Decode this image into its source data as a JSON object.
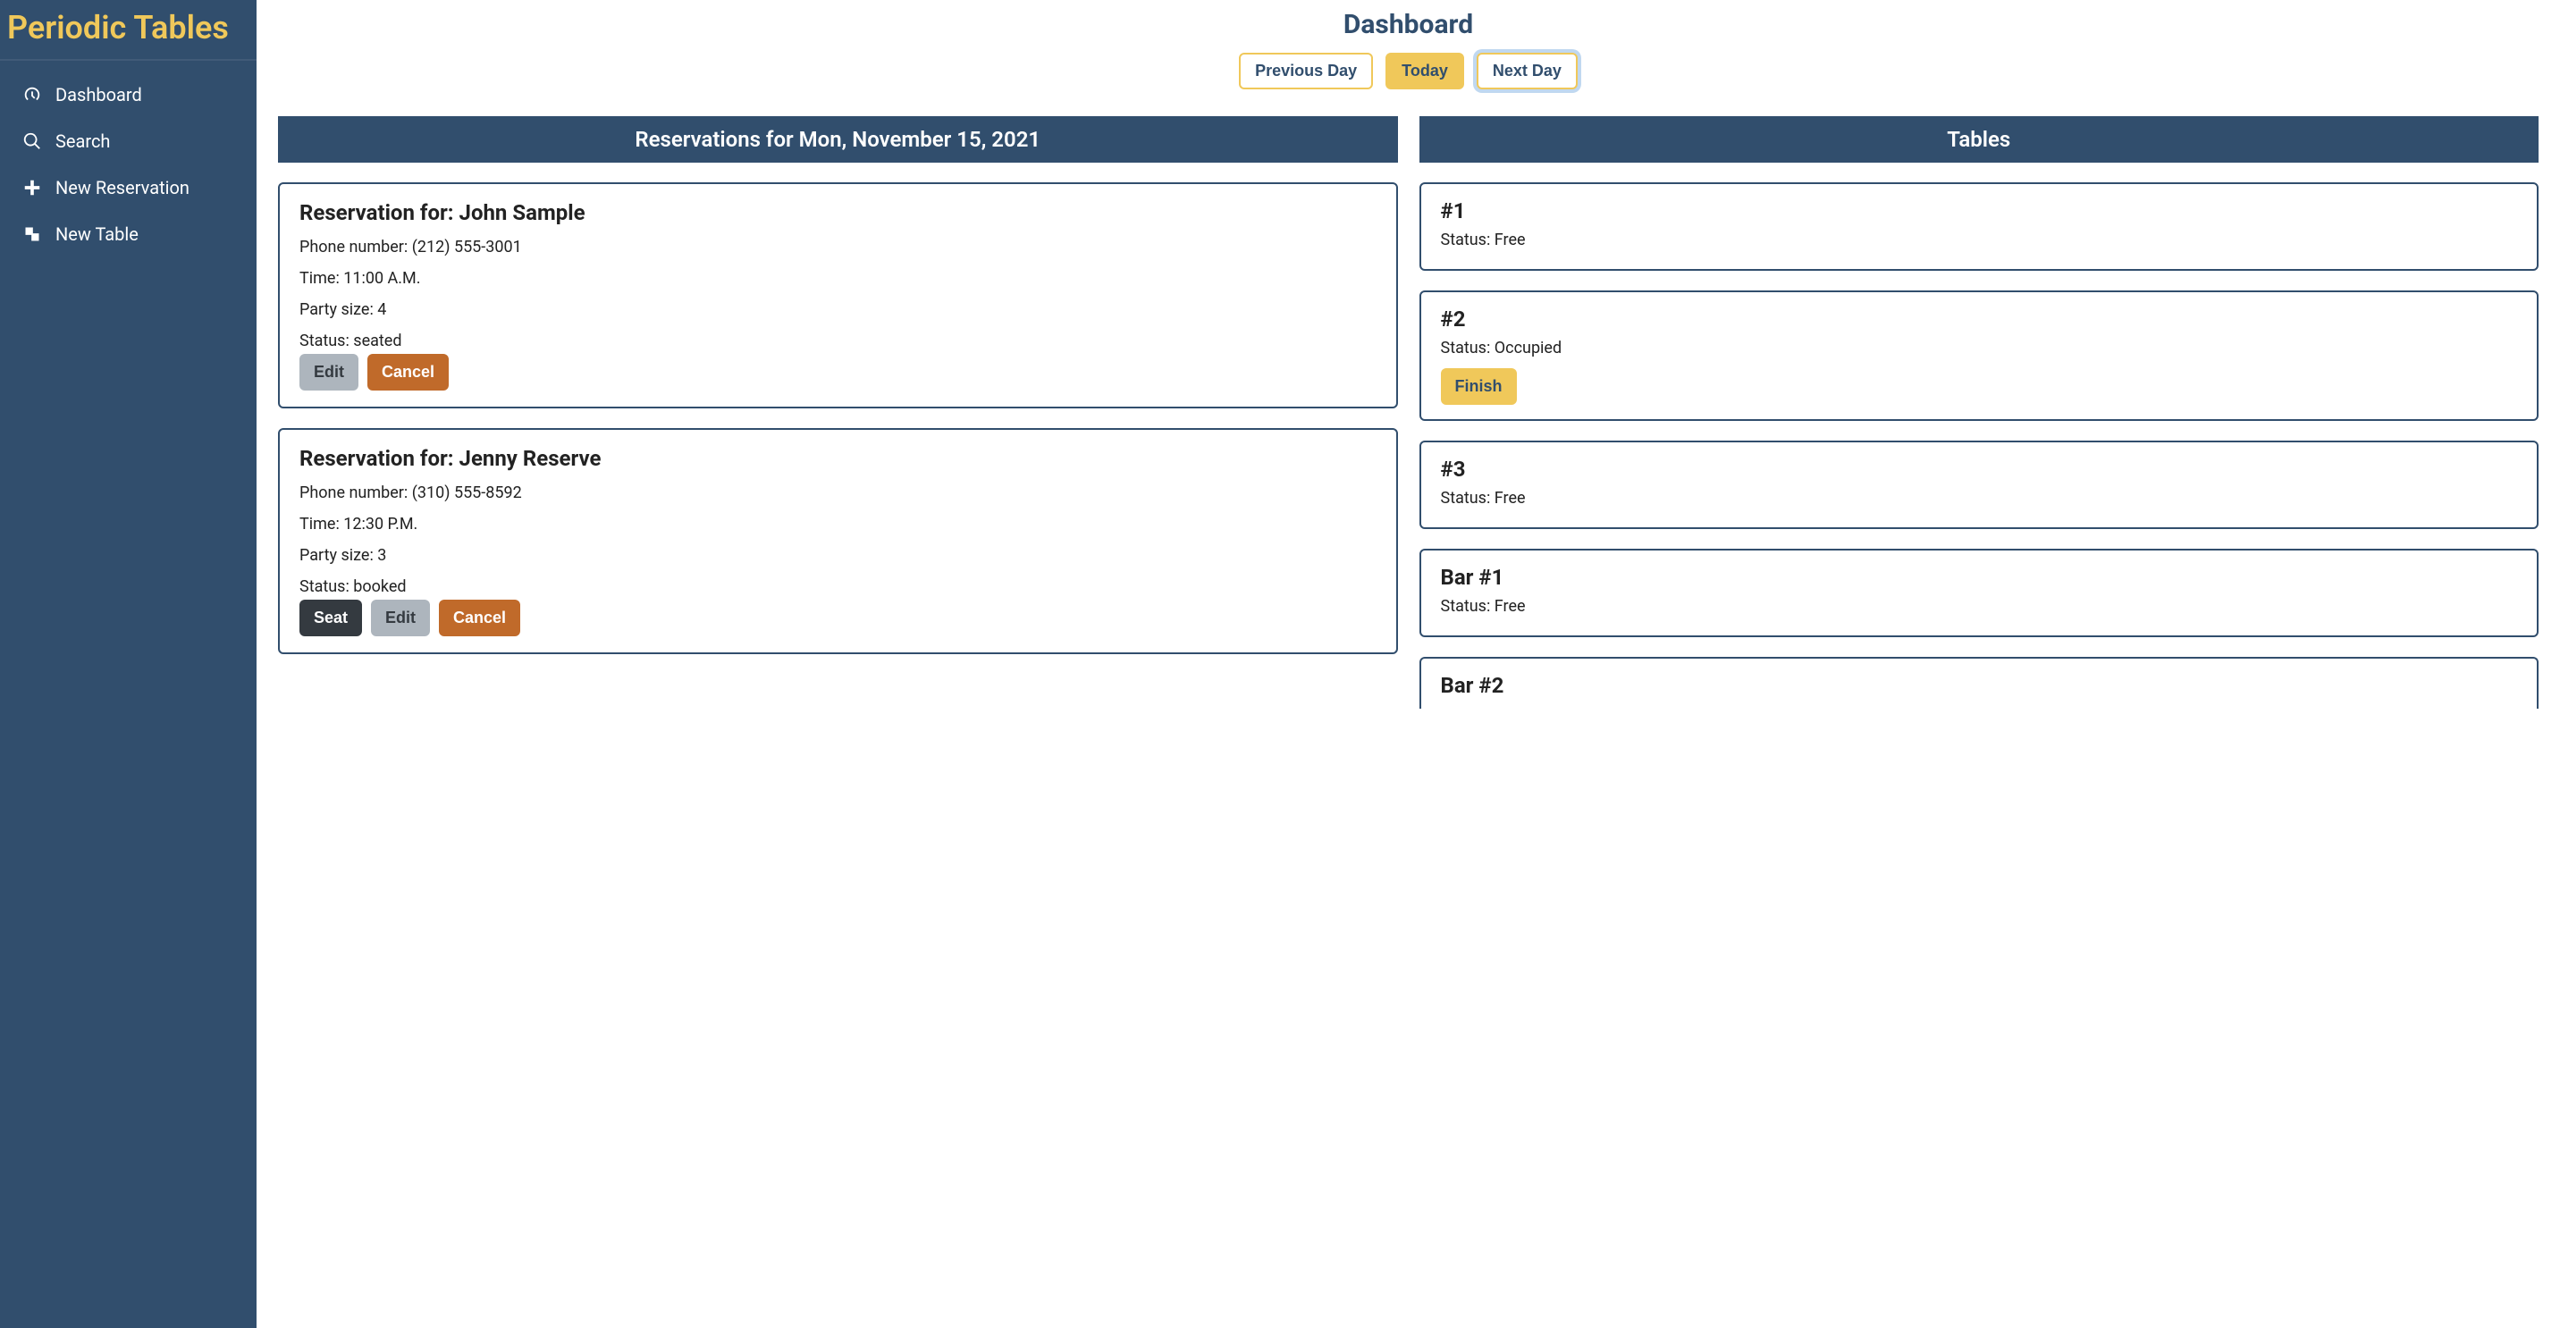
{
  "brand": "Periodic Tables",
  "sidebar": {
    "items": [
      {
        "label": "Dashboard",
        "icon": "gauge-icon"
      },
      {
        "label": "Search",
        "icon": "search-icon"
      },
      {
        "label": "New Reservation",
        "icon": "plus-icon"
      },
      {
        "label": "New Table",
        "icon": "layers-icon"
      }
    ]
  },
  "header": {
    "title": "Dashboard",
    "prev_label": "Previous Day",
    "today_label": "Today",
    "next_label": "Next Day"
  },
  "reservations_header": "Reservations for Mon, November 15, 2021",
  "tables_header": "Tables",
  "labels": {
    "reservation_for_prefix": "Reservation for: ",
    "phone_prefix": "Phone number: ",
    "time_prefix": "Time: ",
    "party_prefix": "Party size: ",
    "status_prefix": "Status: ",
    "seat": "Seat",
    "edit": "Edit",
    "cancel": "Cancel",
    "finish": "Finish"
  },
  "reservations": [
    {
      "name": "John Sample",
      "phone": "(212) 555-3001",
      "time": "11:00 A.M.",
      "party_size": "4",
      "status": "seated",
      "show_seat": false
    },
    {
      "name": "Jenny Reserve",
      "phone": "(310) 555-8592",
      "time": "12:30 P.M.",
      "party_size": "3",
      "status": "booked",
      "show_seat": true
    }
  ],
  "tables": [
    {
      "name": "#1",
      "status": "Free",
      "show_finish": false
    },
    {
      "name": "#2",
      "status": "Occupied",
      "show_finish": true
    },
    {
      "name": "#3",
      "status": "Free",
      "show_finish": false
    },
    {
      "name": "Bar #1",
      "status": "Free",
      "show_finish": false
    },
    {
      "name": "Bar #2",
      "status": "",
      "show_finish": false,
      "truncated": true
    }
  ]
}
